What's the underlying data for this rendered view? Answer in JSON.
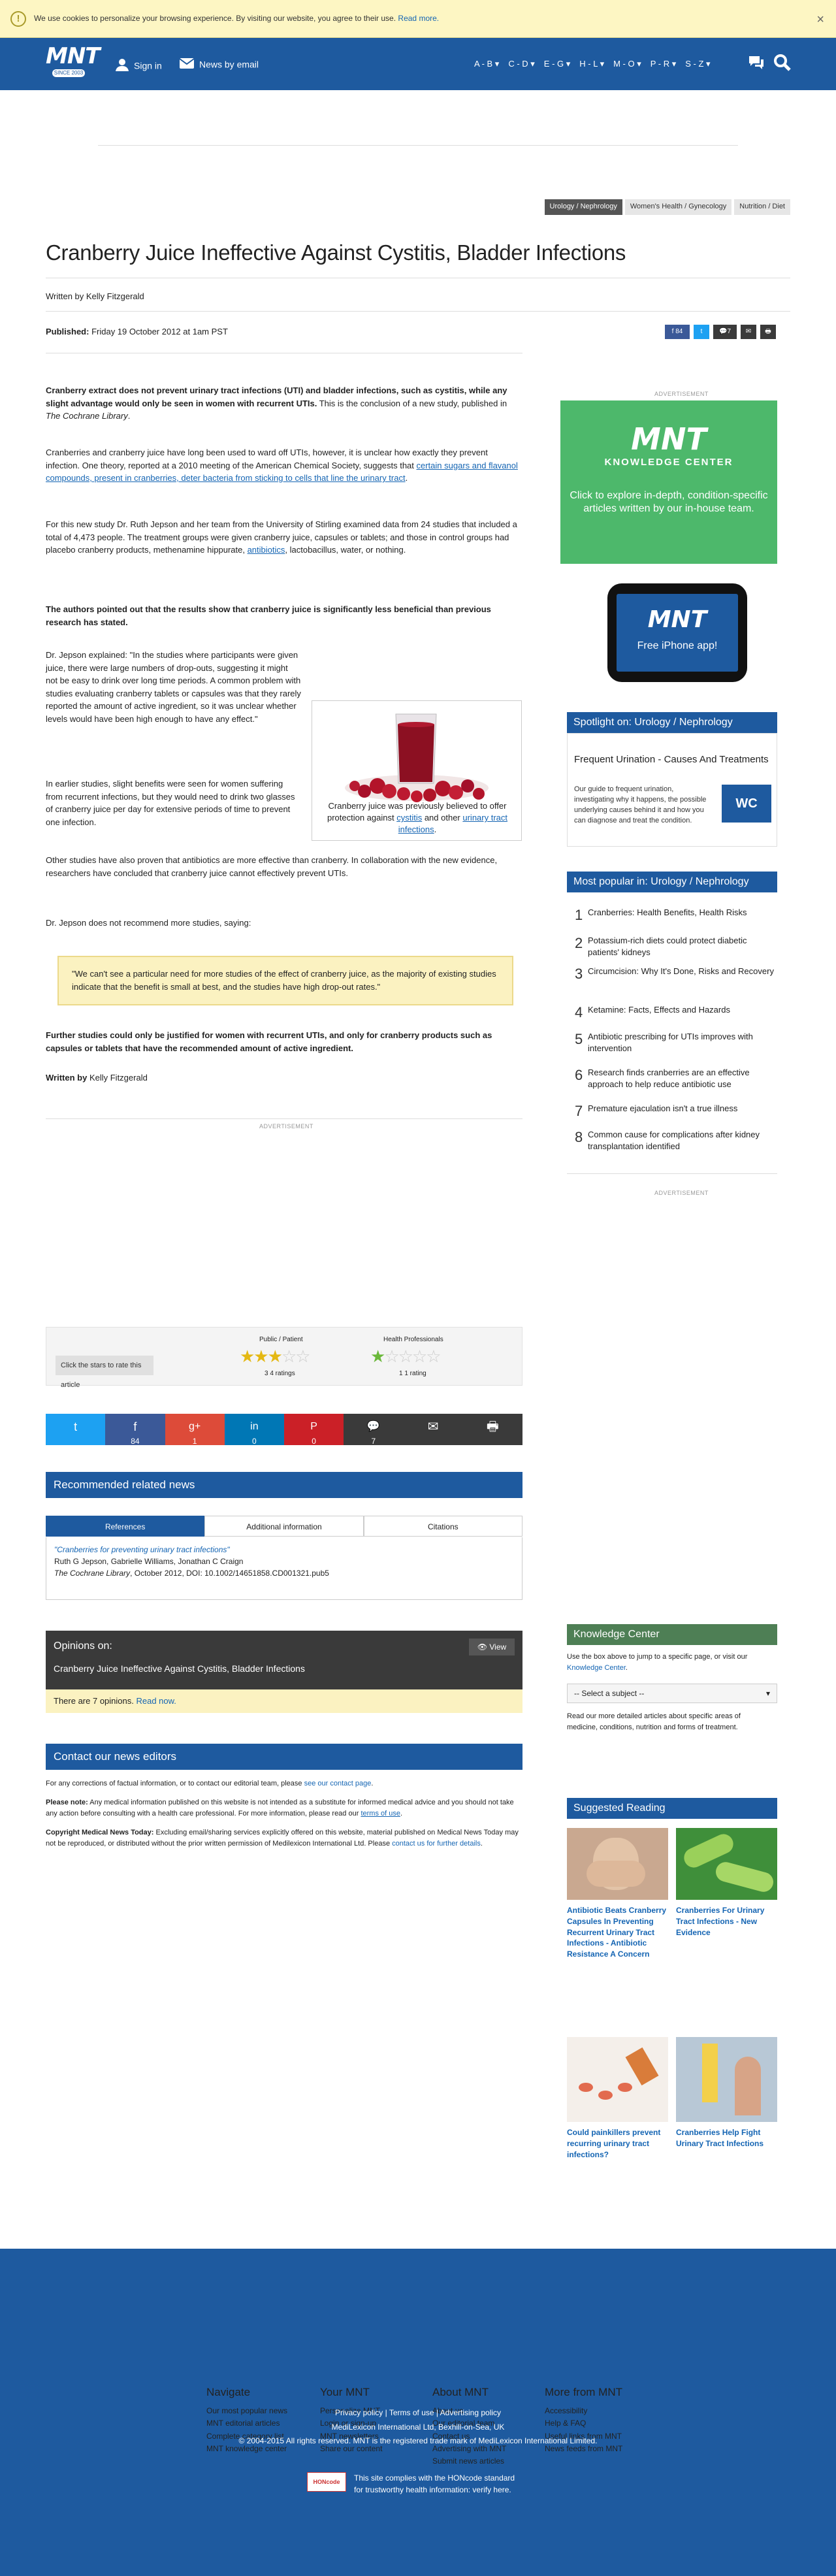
{
  "cookie": {
    "message": "We use cookies to personalize your browsing experience. By visiting our website, you agree to their use.",
    "read_more": "Read more.",
    "close": "×"
  },
  "header": {
    "logo_text": "MNT",
    "logo_since": "SINCE 2003",
    "sign_in": "Sign in",
    "news_by_email": "News by email",
    "az_ranges": [
      "A - B ▾",
      "C - D ▾",
      "E - G ▾",
      "H - L ▾",
      "M - O ▾",
      "P - R ▾",
      "S - Z ▾"
    ]
  },
  "category_tags": [
    "Urology / Nephrology",
    "Women's Health / Gynecology",
    "Nutrition / Diet"
  ],
  "article": {
    "title": "Cranberry Juice Ineffective Against Cystitis, Bladder Infections",
    "byline": "Written by Kelly Fitzgerald",
    "published_label": "Published:",
    "published_date": "Friday 19 October 2012 at 1am PST",
    "share_counts": {
      "facebook": "84",
      "comments": "7"
    },
    "p1_bold": "Cranberry extract does not prevent urinary tract infections (UTI) and bladder infections, such as cystitis, while any slight advantage would only be seen in women with recurrent UTIs.",
    "p1_rest": " This is the conclusion of a new study, published in ",
    "p1_journal": "The Cochrane Library",
    "p1_end": ".",
    "p2_text": "Cranberries and cranberry juice have long been used to ward off UTIs, however, it is unclear how exactly they prevent infection. One theory, reported at a 2010 meeting of the American Chemical Society, suggests that ",
    "p2_link": "certain sugars and flavanol compounds, present in cranberries, deter bacteria from sticking to cells that line the urinary tract",
    "p2_end": ".",
    "p3_text": "For this new study Dr. Ruth Jepson and her team from the University of Stirling examined data from 24 studies that included a total of 4,473 people. The treatment groups were given cranberry juice, capsules or tablets; and those in control groups had placebo cranberry products, methenamine hippurate, ",
    "p3_link": "antibiotics",
    "p3_end": ", lactobacillus, water, or nothing.",
    "p4_bold": "The authors pointed out that the results show that cranberry juice is significantly less beneficial than previous research has stated.",
    "p5": "Dr. Jepson explained: \"In the studies where participants were given juice, there were large numbers of drop-outs, suggesting it might not be easy to drink over long time periods. A common problem with studies evaluating cranberry tablets or capsules was that they rarely reported the amount of active ingredient, so it was unclear whether levels would have been high enough to have any effect.\"",
    "p6": "In earlier studies, slight benefits were seen for women suffering from recurrent infections, but they would need to drink two glasses of cranberry juice per day for extensive periods of time to prevent one infection.",
    "p7": "Other studies have also proven that antibiotics are more effective than cranberry. In collaboration with the new evidence, researchers have concluded that cranberry juice cannot effectively prevent UTIs.",
    "p8": "Dr. Jepson does not recommend more studies, saying:",
    "quote": "\"We can't see a particular need for more studies of the effect of cranberry juice, as the majority of existing studies indicate that the benefit is small at best, and the studies have high drop-out rates.\"",
    "p9_bold": "Further studies could only be justified for women with recurrent UTIs, and only for cranberry products such as capsules or tablets that have the recommended amount of active ingredient.",
    "byline_end_label": "Written by",
    "byline_end_name": "Kelly Fitzgerald",
    "figure_caption_1": "Cranberry juice was previously believed to offer protection against ",
    "figure_link_1": "cystitis",
    "figure_caption_2": " and other ",
    "figure_link_2": "urinary tract infections",
    "figure_caption_3": "."
  },
  "advertisement_label": "ADVERTISEMENT",
  "sidebar": {
    "kc_ad": {
      "logo": "MNT",
      "subtitle": "KNOWLEDGE CENTER",
      "text": "Click to explore in-depth, condition-specific articles written by our in-house team."
    },
    "iphone_ad": {
      "logo": "MNT",
      "text": "Free iPhone app!"
    },
    "spotlight_heading": "Spotlight on: Urology / Nephrology",
    "spotlight_title": "Frequent Urination - Causes And Treatments",
    "spotlight_text": "Our guide to frequent urination, investigating why it happens, the possible underlying causes behind it and how you can diagnose and treat the condition.",
    "spotlight_badge": "WC",
    "popular_heading": "Most popular in: Urology / Nephrology",
    "popular": [
      {
        "n": "1",
        "t": "Cranberries: Health Benefits, Health Risks"
      },
      {
        "n": "2",
        "t": "Potassium-rich diets could protect diabetic patients' kidneys"
      },
      {
        "n": "3",
        "t": "Circumcision: Why It's Done, Risks and Recovery"
      },
      {
        "n": "4",
        "t": "Ketamine: Facts, Effects and Hazards"
      },
      {
        "n": "5",
        "t": "Antibiotic prescribing for UTIs improves with intervention"
      },
      {
        "n": "6",
        "t": "Research finds cranberries are an effective approach to help reduce antibiotic use"
      },
      {
        "n": "7",
        "t": "Premature ejaculation isn't a true illness"
      },
      {
        "n": "8",
        "t": "Common cause for complications after kidney transplantation identified"
      }
    ],
    "kc_heading": "Knowledge Center",
    "kc_text_1": "Use the box above to jump to a specific page, or visit our ",
    "kc_link": "Knowledge Center",
    "kc_text_2": ".",
    "kc_select": "-- Select a subject --",
    "kc_text_3": "Read our more detailed articles about specific areas of medicine, conditions, nutrition and forms of treatment.",
    "sr_heading": "Suggested Reading",
    "suggested": [
      "Antibiotic Beats Cranberry Capsules In Preventing Recurrent Urinary Tract Infections - Antibiotic Resistance A Concern",
      "Cranberries For Urinary Tract Infections - New Evidence",
      "Could painkillers prevent recurring urinary tract infections?",
      "Cranberries Help Fight Urinary Tract Infections"
    ]
  },
  "rating": {
    "label": "Click the stars to rate this article",
    "public_label": "Public / Patient",
    "public_stars": 3,
    "public_count": "3 4 ratings",
    "pro_label": "Health Professionals",
    "pro_stars": 1,
    "pro_count": "1 1 rating"
  },
  "sharebar": [
    {
      "label": "",
      "count": "",
      "color": "#1da1f2"
    },
    {
      "label": "f",
      "count": "84",
      "color": "#3b5998"
    },
    {
      "label": "g+",
      "count": "1",
      "color": "#dd4b39"
    },
    {
      "label": "in",
      "count": "0",
      "color": "#0077b5"
    },
    {
      "label": "P",
      "count": "0",
      "color": "#cb2027"
    },
    {
      "label": "💬",
      "count": "7",
      "color": "#3a3a3a"
    },
    {
      "label": "✉",
      "count": "",
      "color": "#3a3a3a"
    },
    {
      "label": "🖶",
      "count": "",
      "color": "#3a3a3a"
    }
  ],
  "recommended_heading": "Recommended related news",
  "ref_tabs": [
    "References",
    "Additional information",
    "Citations"
  ],
  "references": {
    "title": "\"Cranberries for preventing urinary tract infections\"",
    "authors": "Ruth G Jepson, Gabrielle Williams, Jonathan C Craign",
    "source_journal": "The Cochrane Library",
    "source_rest": ", October 2012, DOI: 10.1002/14651858.CD001321.pub5"
  },
  "opinions": {
    "label": "Opinions on:",
    "title": "Cranberry Juice Ineffective Against Cystitis, Bladder Infections",
    "view": "View",
    "note_pre": "There are ",
    "note_count": "7",
    "note_mid": " opinions. ",
    "note_link": "Read now."
  },
  "contact": {
    "heading": "Contact our news editors",
    "line1": "For any corrections of factual information, or to contact our editorial team, please ",
    "line1_link": "see our contact page",
    "line1_end": ".",
    "note_bold": "Please note:",
    "note_text": " Any medical information published on this website is not intended as a substitute for informed medical advice and you should not take any action before consulting with a health care professional. For more information, please read our ",
    "note_link": "terms of use",
    "note_end": ".",
    "copy_bold": "Copyright Medical News Today:",
    "copy_text": " Excluding email/sharing services explicitly offered on this website, material published on Medical News Today may not be reproduced, or distributed without the prior written permission of Medilexicon International Ltd. Please ",
    "copy_link": "contact us for further details",
    "copy_end": "."
  },
  "footer": {
    "cols": [
      {
        "h": "Navigate",
        "items": [
          "Our most popular news",
          "MNT editorial articles",
          "Complete category list",
          "MNT knowledge center"
        ]
      },
      {
        "h": "Your MNT",
        "items": [
          "Personalize MNT",
          "Login or sign-up",
          "MNT newsletters",
          "Share our content"
        ]
      },
      {
        "h": "About MNT",
        "items": [
          "About us",
          "Our editorial team",
          "Contact us",
          "Advertising with MNT",
          "Submit news articles"
        ]
      },
      {
        "h": "More from MNT",
        "items": [
          "Accessibility",
          "Help & FAQ",
          "Useful links from MNT",
          "News feeds from MNT"
        ]
      }
    ],
    "policy": "Privacy policy | Terms of use | Advertising policy",
    "company": "MediLexicon International Ltd, Bexhill-on-Sea, UK",
    "copyright": "© 2004-2015 All rights reserved. MNT is the registered trade mark of MediLexicon International Limited.",
    "hon_1": "This site complies with the HONcode standard",
    "hon_2": "for trustworthy health information: verify here."
  }
}
